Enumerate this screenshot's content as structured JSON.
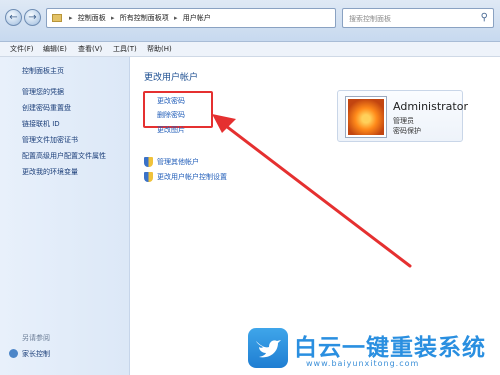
{
  "nav": {
    "back_icon": "back-arrow-icon",
    "forward_icon": "forward-arrow-icon"
  },
  "address": {
    "crumbs": [
      "控制面板",
      "所有控制面板项",
      "用户帐户"
    ],
    "separator": "▸"
  },
  "search": {
    "placeholder": "搜索控制面板"
  },
  "menu": {
    "items": [
      "文件(F)",
      "编辑(E)",
      "查看(V)",
      "工具(T)",
      "帮助(H)"
    ]
  },
  "sidebar": {
    "home": "控制面板主页",
    "items": [
      "管理您的凭据",
      "创建密码重置盘",
      "链接联机 ID",
      "管理文件加密证书",
      "配置高级用户配置文件属性",
      "更改我的环境变量"
    ],
    "see_also": "另请参阅",
    "family": "家长控制"
  },
  "main": {
    "title": "更改用户帐户",
    "links": [
      "更改密码",
      "删除密码",
      "更改图片"
    ],
    "admin_links": [
      "管理其他帐户",
      "更改用户帐户控制设置"
    ]
  },
  "account": {
    "name": "Administrator",
    "role": "管理员",
    "status": "密码保护"
  },
  "watermark": {
    "title": "白云一键重装系统",
    "url": "www.baiyunxitong.com"
  },
  "colors": {
    "highlight": "#e53030",
    "link": "#1f5cb8"
  }
}
